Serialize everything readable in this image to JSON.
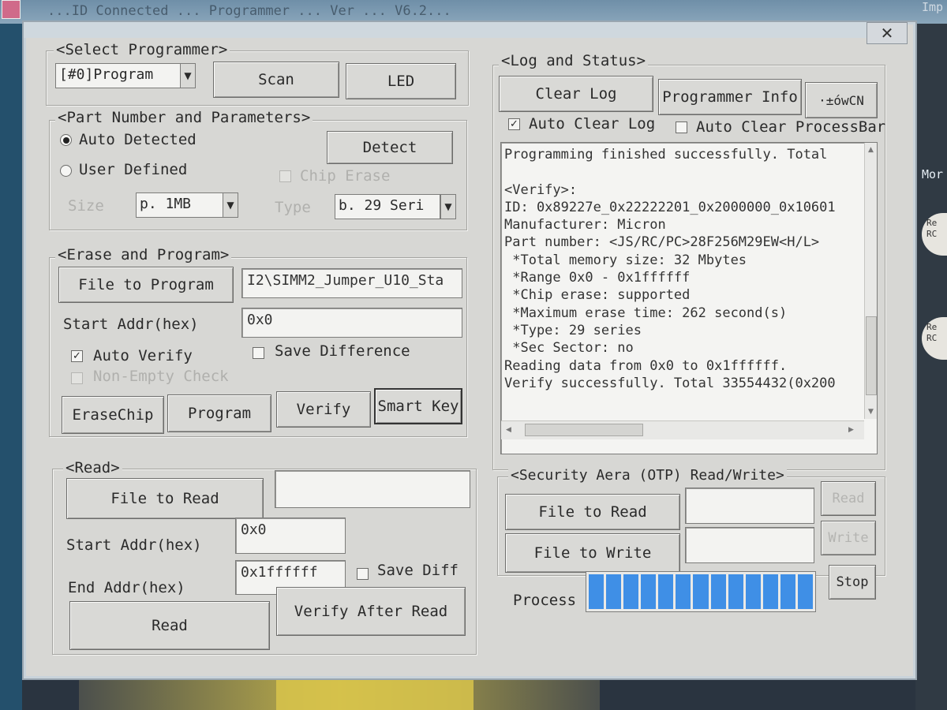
{
  "background": {
    "titlebar_text": "...ID Connected ... Programmer ... Ver ... V6.2...",
    "right_label": "Imp",
    "right_more": "Mor",
    "badge_1": "Re\nRC",
    "badge_2": "Re\nRC"
  },
  "window": {
    "close_label": "✕"
  },
  "select_programmer": {
    "legend": "<Select Programmer>",
    "programmer_value": "[#0]Program",
    "scan_label": "Scan",
    "led_label": "LED"
  },
  "part_number": {
    "legend": "<Part Number and Parameters>",
    "auto_detected_label": "Auto Detected",
    "auto_detected_selected": true,
    "user_defined_label": "User Defined",
    "detect_label": "Detect",
    "chip_erase_label": "Chip Erase",
    "size_label": "Size",
    "size_value": "p. 1MB",
    "type_label": "Type",
    "type_value": "b. 29 Seri"
  },
  "erase_program": {
    "legend": "<Erase and Program>",
    "file_to_program_label": "File to Program",
    "file_path": "I2\\SIMM2_Jumper_U10_Sta",
    "start_addr_label": "Start Addr(hex)",
    "start_addr_value": "0x0",
    "auto_verify_label": "Auto Verify",
    "auto_verify_checked": true,
    "save_difference_label": "Save Difference",
    "non_empty_check_label": "Non-Empty Check",
    "erase_chip_label": "EraseChip",
    "program_label": "Program",
    "verify_label": "Verify",
    "smart_key_label": "Smart Key"
  },
  "read": {
    "legend": "<Read>",
    "file_to_read_label": "File to Read",
    "file_value": "",
    "start_addr_label": "Start Addr(hex)",
    "start_addr_value": "0x0",
    "end_addr_label": "End Addr(hex)",
    "end_addr_value": "0x1ffffff",
    "save_diff_label": "Save Diff",
    "read_label": "Read",
    "verify_after_read_label": "Verify After Read"
  },
  "log_status": {
    "legend": "<Log and Status>",
    "clear_log_label": "Clear Log",
    "programmer_info_label": "Programmer Info",
    "extra_button_label": "·±ówCN",
    "auto_clear_log_label": "Auto Clear Log",
    "auto_clear_log_checked": true,
    "auto_clear_processbar_label": "Auto Clear ProcessBar",
    "log_lines": [
      "Programming finished successfully. Total",
      "",
      "<Verify>:",
      "ID: 0x89227e_0x22222201_0x2000000_0x10601",
      "Manufacturer: Micron",
      "Part number: <JS/RC/PC>28F256M29EW<H/L>",
      " *Total memory size: 32 Mbytes",
      " *Range 0x0 - 0x1ffffff",
      " *Chip erase: supported",
      " *Maximum erase time: 262 second(s)",
      " *Type: 29 series",
      " *Sec Sector: no",
      "Reading data from 0x0 to 0x1ffffff.",
      "Verify successfully. Total 33554432(0x200"
    ]
  },
  "security": {
    "legend": "<Security Aera (OTP) Read/Write>",
    "file_to_read_label": "File to Read",
    "file_to_write_label": "File to Write",
    "read_label": "Read",
    "write_label": "Write"
  },
  "process": {
    "label": "Process",
    "progress_fraction": 1.0,
    "block_count": 13,
    "stop_label": "Stop",
    "bar_color": "#3f8fe6"
  }
}
